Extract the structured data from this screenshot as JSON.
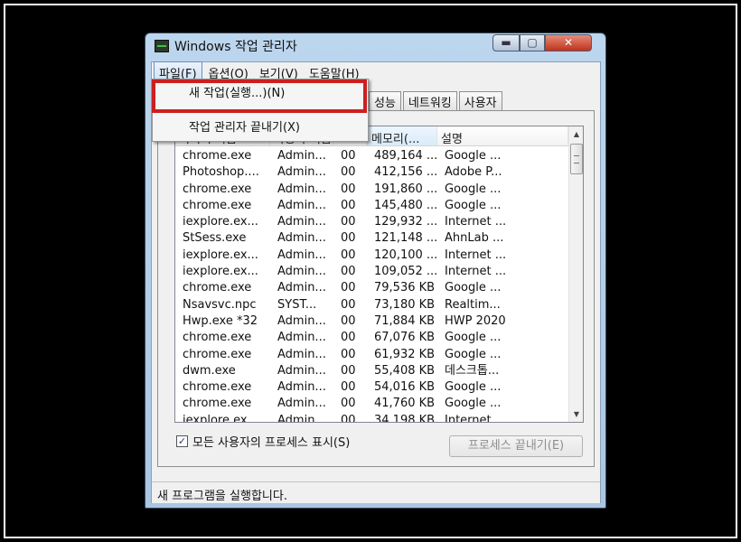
{
  "window": {
    "title": "Windows 작업 관리자",
    "minimize": "▬",
    "maximize": "▢",
    "close": "✕"
  },
  "menubar": {
    "items": [
      "파일(F)",
      "옵션(O)",
      "보기(V)",
      "도움말(H)"
    ]
  },
  "file_menu": {
    "new_task": "새 작업(실행...)(N)",
    "exit": "작업 관리자 끝내기(X)"
  },
  "tabs": [
    "성능",
    "네트워킹",
    "사용자"
  ],
  "processes": {
    "columns": [
      "이미지 이름",
      "사용자 이름",
      "CPU",
      "메모리(...",
      "설명"
    ],
    "rows": [
      [
        "chrome.exe",
        "Admin...",
        "00",
        "489,164 ...",
        "Google ..."
      ],
      [
        "Photoshop....",
        "Admin...",
        "00",
        "412,156 ...",
        "Adobe P..."
      ],
      [
        "chrome.exe",
        "Admin...",
        "00",
        "191,860 ...",
        "Google ..."
      ],
      [
        "chrome.exe",
        "Admin...",
        "00",
        "145,480 ...",
        "Google ..."
      ],
      [
        "iexplore.ex...",
        "Admin...",
        "00",
        "129,932 ...",
        "Internet ..."
      ],
      [
        "StSess.exe",
        "Admin...",
        "00",
        "121,148 ...",
        "AhnLab ..."
      ],
      [
        "iexplore.ex...",
        "Admin...",
        "00",
        "120,100 ...",
        "Internet ..."
      ],
      [
        "iexplore.ex...",
        "Admin...",
        "00",
        "109,052 ...",
        "Internet ..."
      ],
      [
        "chrome.exe",
        "Admin...",
        "00",
        "79,536 KB",
        "Google ..."
      ],
      [
        "Nsavsvc.npc",
        "SYST...",
        "00",
        "73,180 KB",
        "Realtim..."
      ],
      [
        "Hwp.exe *32",
        "Admin...",
        "00",
        "71,884 KB",
        "HWP 2020"
      ],
      [
        "chrome.exe",
        "Admin...",
        "00",
        "67,076 KB",
        "Google ..."
      ],
      [
        "chrome.exe",
        "Admin...",
        "00",
        "61,932 KB",
        "Google ..."
      ],
      [
        "dwm.exe",
        "Admin...",
        "00",
        "55,408 KB",
        "데스크톱..."
      ],
      [
        "chrome.exe",
        "Admin...",
        "00",
        "54,016 KB",
        "Google ..."
      ],
      [
        "chrome.exe",
        "Admin...",
        "00",
        "41,760 KB",
        "Google ..."
      ],
      [
        "iexplore.ex...",
        "Admin...",
        "00",
        "34,198 KB",
        "Internet ..."
      ]
    ]
  },
  "show_all": {
    "checked": "✓",
    "label": "모든 사용자의 프로세스 표시(S)"
  },
  "end_process": "프로세스 끝내기(E)",
  "status": "새 프로그램을 실행합니다.",
  "colors": {
    "highlight": "#cc1f1f",
    "titlebar": "#bcd6ee",
    "close_button": "#c1321c"
  },
  "icons": {
    "app": "task-manager-icon",
    "scroll_up": "▲",
    "scroll_down": "▼"
  }
}
